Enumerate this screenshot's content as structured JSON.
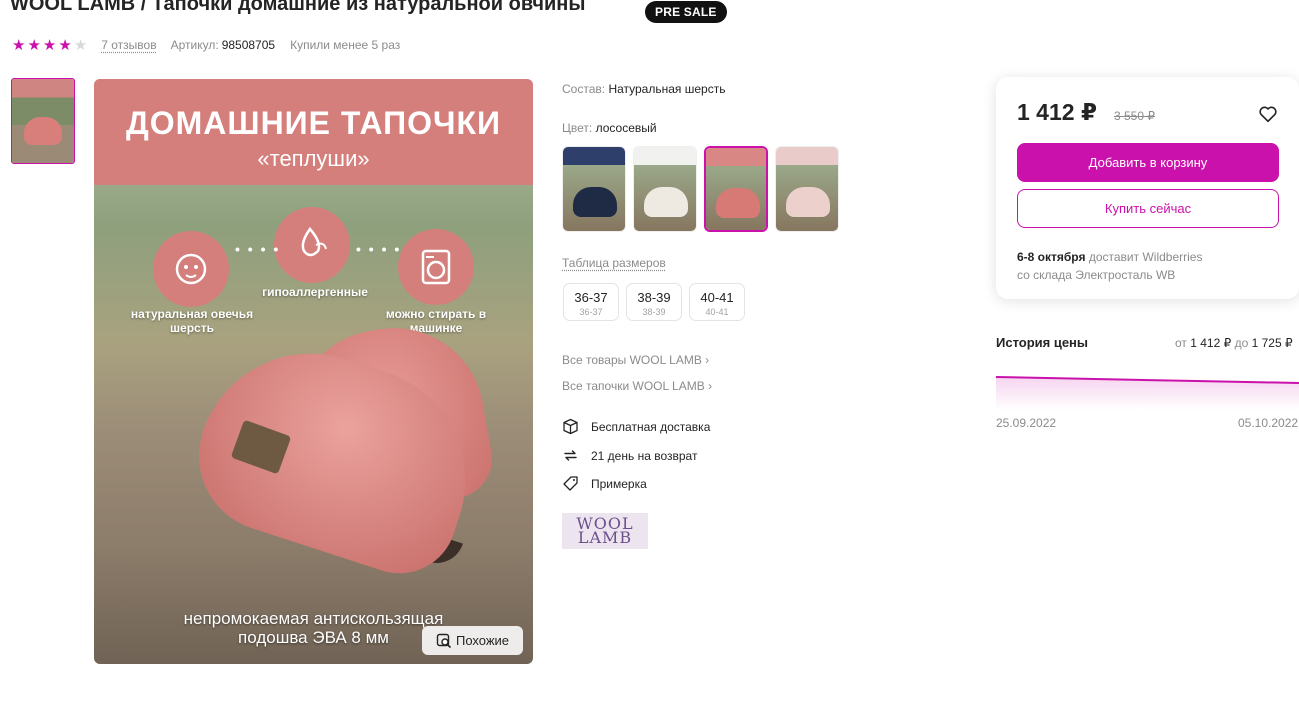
{
  "product": {
    "title": "WOOL LAMB / Тапочки домашние из натуральной овчины",
    "badge": "PRE SALE",
    "rating": 4,
    "reviews": "7 отзывов",
    "article_label": "Артикул:",
    "article": "98508705",
    "purchased": "Купили менее 5 раз"
  },
  "image": {
    "headline": "ДОМАШНИЕ ТАПОЧКИ",
    "subheadline": "«теплуши»",
    "feature1": "натуральная овечья шерсть",
    "feature2": "гипоаллергенные",
    "feature3": "можно стирать в машинке",
    "bottom_line1": "непромокаемая антискользящая",
    "bottom_line2": "подошва ЭВА 8 мм",
    "similar_button": "Похожие"
  },
  "details": {
    "composition_label": "Состав:",
    "composition": "Натуральная шерсть",
    "color_label": "Цвет:",
    "color": "лососевый",
    "size_table": "Таблица размеров",
    "sizes": [
      {
        "size": "36-37",
        "ru": "36-37"
      },
      {
        "size": "38-39",
        "ru": "38-39"
      },
      {
        "size": "40-41",
        "ru": "40-41"
      }
    ],
    "all_brand": "Все товары WOOL LAMB",
    "all_slippers": "Все тапочки WOOL LAMB",
    "free_delivery": "Бесплатная доставка",
    "returns": "21 день на возврат",
    "fitting": "Примерка",
    "brand_logo_line1": "WOOL",
    "brand_logo_line2": "LAMB"
  },
  "buy": {
    "price": "1 412 ₽",
    "old_price": "3 550 ₽",
    "add_to_cart": "Добавить в корзину",
    "buy_now": "Купить сейчас",
    "delivery_date": "6-8 октября",
    "delivery_by": "доставит Wildberries",
    "warehouse": "со склада Электросталь WB"
  },
  "price_history": {
    "title": "История цены",
    "from_label": "от",
    "from": "1 412 ₽",
    "to_label": "до",
    "to": "1 725 ₽",
    "start_date": "25.09.2022",
    "end_date": "05.10.2022"
  },
  "colors": {
    "accent": "#cb11ab",
    "banner": "#d47f7c"
  }
}
